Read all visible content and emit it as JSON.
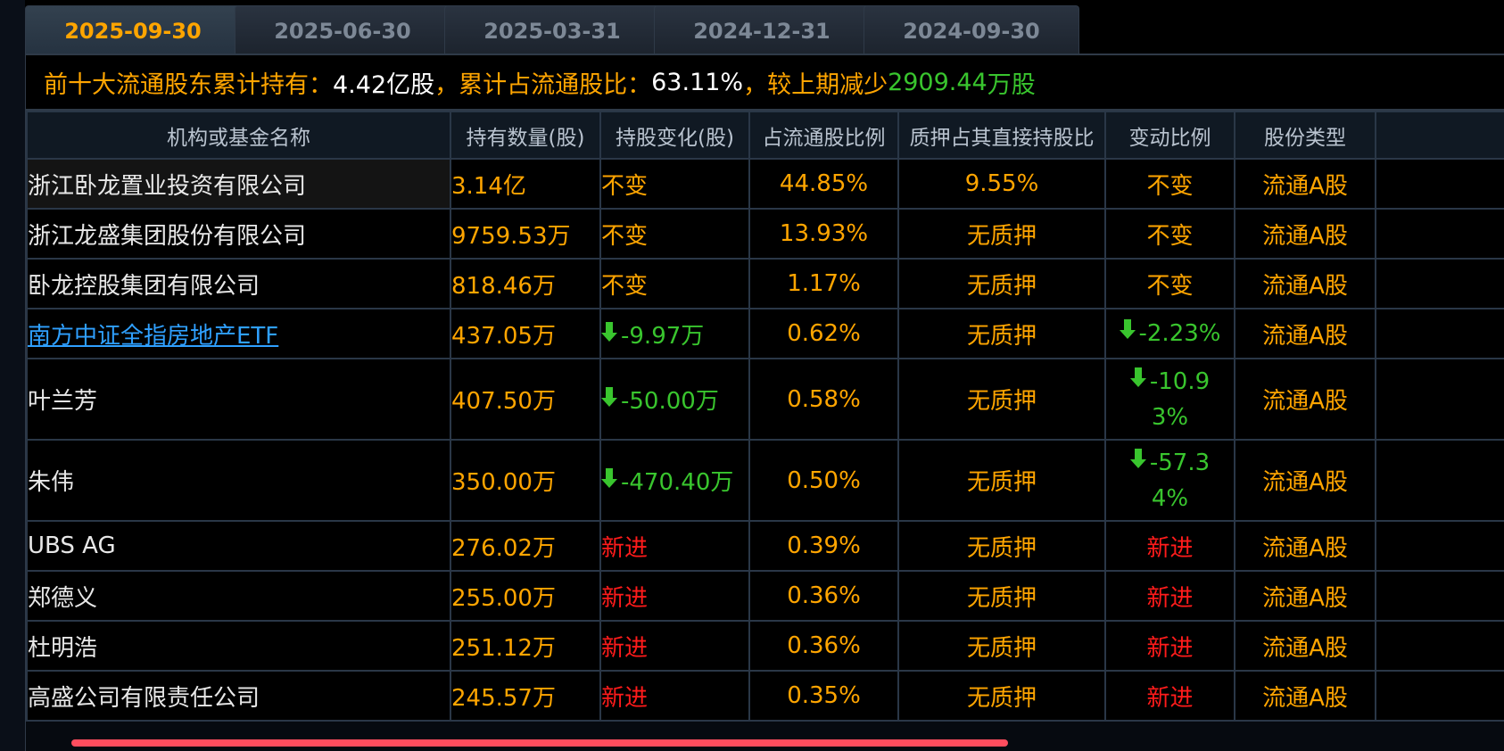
{
  "tabs": [
    {
      "label": "2025-09-30",
      "active": true
    },
    {
      "label": "2025-06-30",
      "active": false
    },
    {
      "label": "2025-03-31",
      "active": false
    },
    {
      "label": "2024-12-31",
      "active": false
    },
    {
      "label": "2024-09-30",
      "active": false
    }
  ],
  "summary": {
    "prefix": "前十大流通股东累计持有：",
    "total_shares": "4.42亿股",
    "ratio_label": "，累计占流通股比：",
    "ratio": "63.11%",
    "change_label": "，较上期减少",
    "change_value": "2909.44",
    "change_unit": "万股"
  },
  "table": {
    "headers": [
      "机构或基金名称",
      "持有数量(股)",
      "持股变化(股)",
      "占流通股比例",
      "质押占其直接持股比",
      "变动比例",
      "股份类型"
    ],
    "rows": [
      {
        "name": "浙江卧龙置业投资有限公司",
        "link": false,
        "shares": "3.14亿",
        "change": "不变",
        "change_dir": "same",
        "ratio": "44.85%",
        "pledge": "9.55%",
        "change_ratio": "不变",
        "type": "流通A股"
      },
      {
        "name": "浙江龙盛集团股份有限公司",
        "link": false,
        "shares": "9759.53万",
        "change": "不变",
        "change_dir": "same",
        "ratio": "13.93%",
        "pledge": "无质押",
        "change_ratio": "不变",
        "type": "流通A股"
      },
      {
        "name": "卧龙控股集团有限公司",
        "link": false,
        "shares": "818.46万",
        "change": "不变",
        "change_dir": "same",
        "ratio": "1.17%",
        "pledge": "无质押",
        "change_ratio": "不变",
        "type": "流通A股"
      },
      {
        "name": "南方中证全指房地产ETF",
        "link": true,
        "shares": "437.05万",
        "change": "-9.97万",
        "change_dir": "down",
        "ratio": "0.62%",
        "pledge": "无质押",
        "change_ratio": "-2.23%",
        "type": "流通A股"
      },
      {
        "name": "叶兰芳",
        "link": false,
        "shares": "407.50万",
        "change": "-50.00万",
        "change_dir": "down",
        "ratio": "0.58%",
        "pledge": "无质押",
        "change_ratio": "-10.93%",
        "type": "流通A股"
      },
      {
        "name": "朱伟",
        "link": false,
        "shares": "350.00万",
        "change": "-470.40万",
        "change_dir": "down",
        "ratio": "0.50%",
        "pledge": "无质押",
        "change_ratio": "-57.34%",
        "type": "流通A股"
      },
      {
        "name": "UBS AG",
        "link": false,
        "shares": "276.02万",
        "change": "新进",
        "change_dir": "new",
        "ratio": "0.39%",
        "pledge": "无质押",
        "change_ratio": "新进",
        "type": "流通A股"
      },
      {
        "name": "郑德义",
        "link": false,
        "shares": "255.00万",
        "change": "新进",
        "change_dir": "new",
        "ratio": "0.36%",
        "pledge": "无质押",
        "change_ratio": "新进",
        "type": "流通A股"
      },
      {
        "name": "杜明浩",
        "link": false,
        "shares": "251.12万",
        "change": "新进",
        "change_dir": "new",
        "ratio": "0.36%",
        "pledge": "无质押",
        "change_ratio": "新进",
        "type": "流通A股"
      },
      {
        "name": "高盛公司有限责任公司",
        "link": false,
        "shares": "245.57万",
        "change": "新进",
        "change_dir": "new",
        "ratio": "0.35%",
        "pledge": "无质押",
        "change_ratio": "新进",
        "type": "流通A股"
      }
    ]
  },
  "colors": {
    "accent": "#ffa500",
    "up_down_green": "#39c52e",
    "new_red": "#ff1b1b",
    "link_blue": "#2fa0ff",
    "scrollbar": "#ff4d5e"
  },
  "icons": {
    "down_arrow": "down-arrow-icon"
  }
}
